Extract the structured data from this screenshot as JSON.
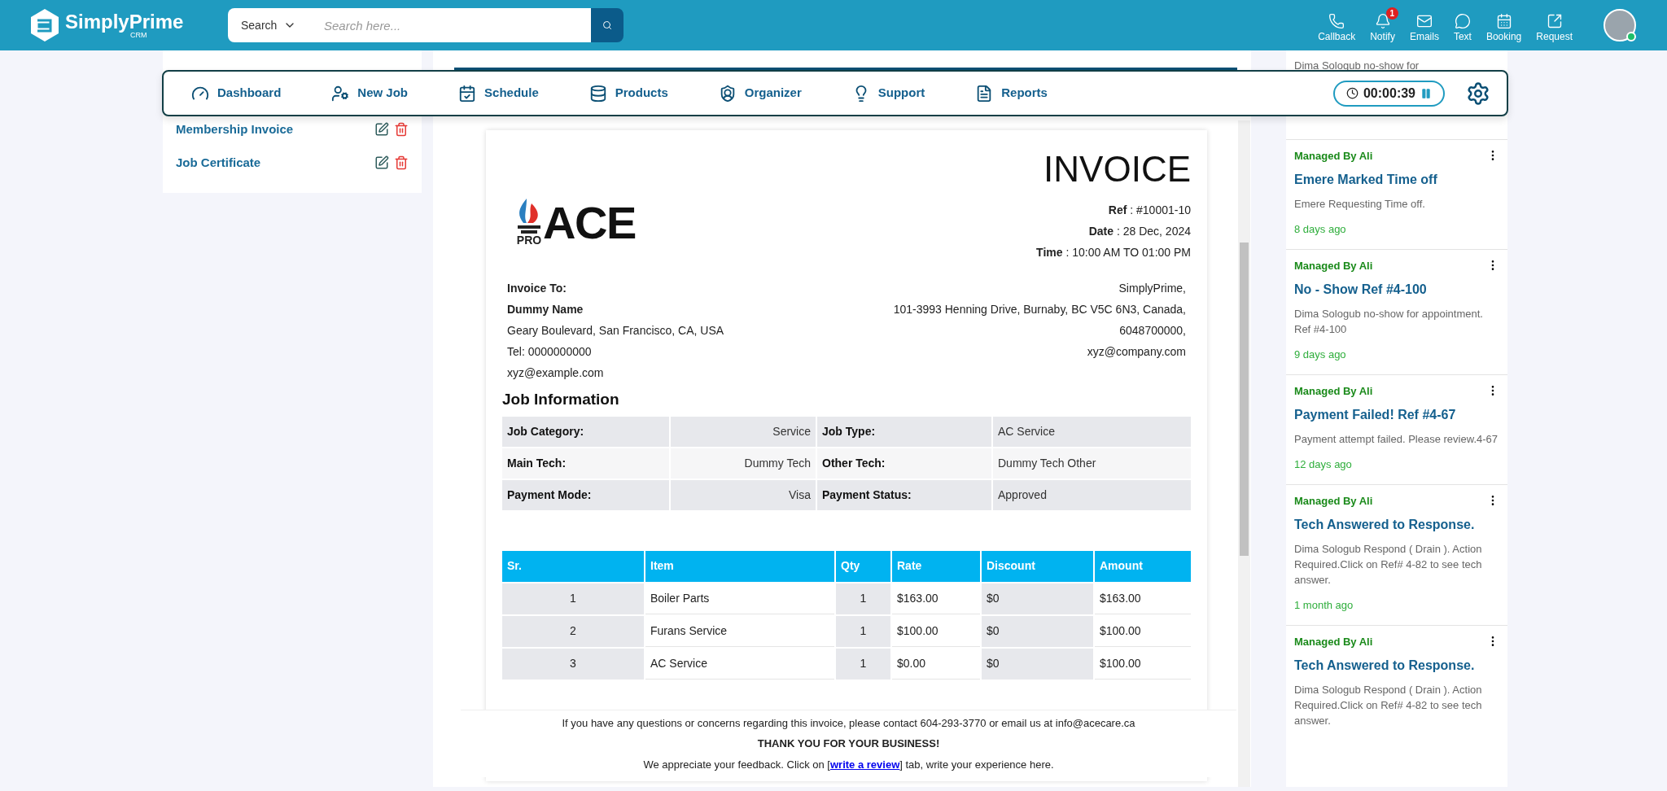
{
  "header": {
    "logo": "SimplyPrime",
    "logo_sub": "CRM",
    "search": {
      "scope": "Search",
      "placeholder": "Search here..."
    },
    "actions": [
      {
        "label": "Callback"
      },
      {
        "label": "Notify",
        "badge": "1"
      },
      {
        "label": "Emails"
      },
      {
        "label": "Text"
      },
      {
        "label": "Booking"
      },
      {
        "label": "Request"
      }
    ]
  },
  "nav": {
    "items": [
      "Dashboard",
      "New Job",
      "Schedule",
      "Products",
      "Organizer",
      "Support",
      "Reports"
    ],
    "timer": "00:00:39"
  },
  "left_panel": {
    "items": [
      "Membership Invoice",
      "Job Certificate"
    ]
  },
  "invoice": {
    "title": "INVOICE",
    "logo_small": "PRO",
    "logo_big": "ACE",
    "meta": [
      {
        "label": "Ref",
        "value": ": #10001-10"
      },
      {
        "label": "Date",
        "value": ": 28 Dec, 2024"
      },
      {
        "label": "Time",
        "value": ": 10:00 AM TO 01:00 PM"
      }
    ],
    "bill_to": {
      "heading": "Invoice To:",
      "name": "Dummy Name",
      "lines": [
        "Geary Boulevard, San Francisco, CA, USA",
        "Tel: 0000000000",
        "xyz@example.com"
      ]
    },
    "from": [
      "SimplyPrime,",
      "101-3993 Henning Drive, Burnaby, BC V5C 6N3, Canada,",
      "6048700000,",
      "xyz@company.com"
    ],
    "job_heading": "Job Information",
    "job_rows": [
      [
        "Job Category:",
        "Service",
        "Job Type:",
        "AC Service"
      ],
      [
        "Main Tech:",
        "Dummy Tech",
        "Other Tech:",
        "Dummy Tech Other"
      ],
      [
        "Payment Mode:",
        "Visa",
        "Payment Status:",
        "Approved"
      ]
    ],
    "items": {
      "columns": [
        "Sr.",
        "Item",
        "Qty",
        "Rate",
        "Discount",
        "Amount"
      ],
      "rows": [
        [
          "1",
          "Boiler Parts",
          "1",
          "$163.00",
          "$0",
          "$163.00"
        ],
        [
          "2",
          "Furans Service",
          "1",
          "$100.00",
          "$0",
          "$100.00"
        ],
        [
          "3",
          "AC Service",
          "1",
          "$0.00",
          "$0",
          "$100.00"
        ]
      ]
    },
    "footer": {
      "contact": "If you have any questions or concerns regarding this invoice, please contact 604-293-3770 or email us at info@acecare.ca",
      "thanks": "THANK YOU FOR YOUR BUSINESS!",
      "review_before": "We appreciate your feedback. Click on [",
      "review_link": "write a review",
      "review_after": "] tab, write your experience here."
    }
  },
  "right_panel": {
    "partial": "Dima Sologub no-show for",
    "cards": [
      {
        "manager": "Managed By Ali",
        "title": "Emere Marked Time off",
        "body": "Emere Requesting Time off.",
        "time": "8 days ago"
      },
      {
        "manager": "Managed By Ali",
        "title": "No - Show Ref #4-100",
        "body": "Dima Sologub no-show for appointment. Ref #4-100",
        "time": "9 days ago"
      },
      {
        "manager": "Managed By Ali",
        "title": "Payment Failed! Ref #4-67",
        "body": "Payment attempt failed. Please review.4-67",
        "time": "12 days ago"
      },
      {
        "manager": "Managed By Ali",
        "title": "Tech Answered to Response.",
        "body": "Dima Sologub Respond ( Drain ). Action Required.Click on Ref# 4-82 to see tech answer.",
        "time": "1 month ago"
      },
      {
        "manager": "Managed By Ali",
        "title": "Tech Answered to Response.",
        "body": "Dima Sologub Respond ( Drain ). Action Required.Click on Ref# 4-82 to see tech answer."
      }
    ]
  }
}
